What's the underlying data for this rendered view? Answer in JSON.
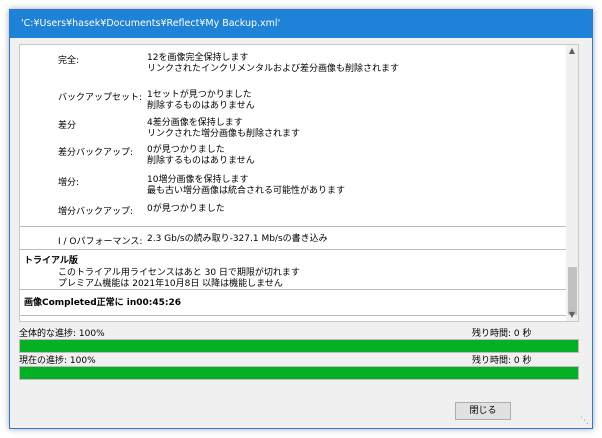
{
  "window": {
    "title": "'C:¥Users¥hasek¥Documents¥Reflect¥My Backup.xml'"
  },
  "log": {
    "entries": [
      {
        "label": "完全:",
        "lines": [
          "12を画像完全保持します",
          "リンクされたインクリメンタルおよび差分画像も削除されます"
        ]
      },
      {
        "label": "バックアップセット:",
        "lines": [
          "1セットが見つかりました",
          "削除するものはありません"
        ]
      },
      {
        "label": "差分",
        "lines": [
          "4差分画像を保持します",
          "リンクされた増分画像も削除されます"
        ]
      },
      {
        "label": "差分バックアップ:",
        "lines": [
          "0が見つかりました",
          "削除するものはありません"
        ]
      },
      {
        "label": "増分:",
        "lines": [
          "10増分画像を保持します",
          "最も古い増分画像は統合される可能性があります"
        ]
      },
      {
        "label": "増分バックアップ:",
        "lines": [
          "0が見つかりました"
        ]
      }
    ],
    "performance": {
      "label": "I / Oパフォーマンス:",
      "value": "2.3 Gb/sの読み取り-327.1 Mb/sの書き込み"
    },
    "trial": {
      "heading": "トライアル版",
      "lines": [
        "このトライアル用ライセンスはあと 30 日で期限が切れます",
        "プレミアム機能は 2021年10月8日 以降は機能しません"
      ]
    },
    "status": "画像Completed正常に in00:45:26"
  },
  "progress": {
    "overall": {
      "label": "全体的な進捗: 100%",
      "remaining": "残り時間: 0 秒",
      "percent": 100
    },
    "current": {
      "label": "現在の進捗: 100%",
      "remaining": "残り時間: 0 秒",
      "percent": 100
    }
  },
  "buttons": {
    "close": "閉じる"
  },
  "icons": {
    "scroll_up": "chevron-up-icon",
    "scroll_down": "chevron-down-icon",
    "resize": "resize-grip-icon"
  },
  "colors": {
    "titlebar": "#1f82d9",
    "progress_fill": "#06b025"
  }
}
